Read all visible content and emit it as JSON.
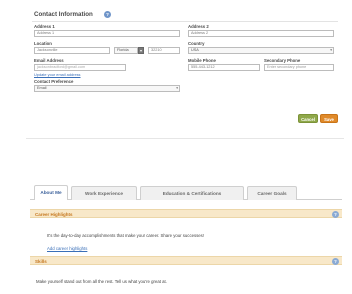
{
  "contact": {
    "title": "Contact Information",
    "address1": {
      "label": "Address 1",
      "value": "Address 1"
    },
    "address2": {
      "label": "Address 2",
      "value": "Address 2"
    },
    "location": {
      "label": "Location",
      "city": "Jacksonville",
      "state": "Florida",
      "zip": "32210"
    },
    "country": {
      "label": "Country",
      "value": "USA"
    },
    "email": {
      "label": "Email Address",
      "value": "jacksonbradford@gmail.com",
      "update_link": "Update your email address"
    },
    "mobile": {
      "label": "Mobile Phone",
      "value": "555-443-1212"
    },
    "secondary": {
      "label": "Secondary Phone",
      "placeholder": "Enter secondary phone"
    },
    "preference": {
      "label": "Contact Preference",
      "value": "Email"
    },
    "cancel_label": "Cancel",
    "save_label": "Save"
  },
  "tabs": [
    {
      "label": "About Me",
      "active": true
    },
    {
      "label": "Work Experience",
      "active": false
    },
    {
      "label": "Education & Certifications",
      "active": false
    },
    {
      "label": "Career Goals",
      "active": false
    }
  ],
  "career_highlights": {
    "title": "Career Highlights",
    "description": "It's the day-to-day accomplishments that make your career. Share your successes!",
    "add_link": "Add career highlights"
  },
  "skills": {
    "title": "Skills",
    "description": "Make yourself stand out from all the rest. Tell us what you're great at."
  },
  "colors": {
    "accent_blue": "#3a6fb8",
    "panel_header": "#f8e8c9",
    "save_orange": "#e08a2a",
    "cancel_green": "#8fa84a"
  }
}
